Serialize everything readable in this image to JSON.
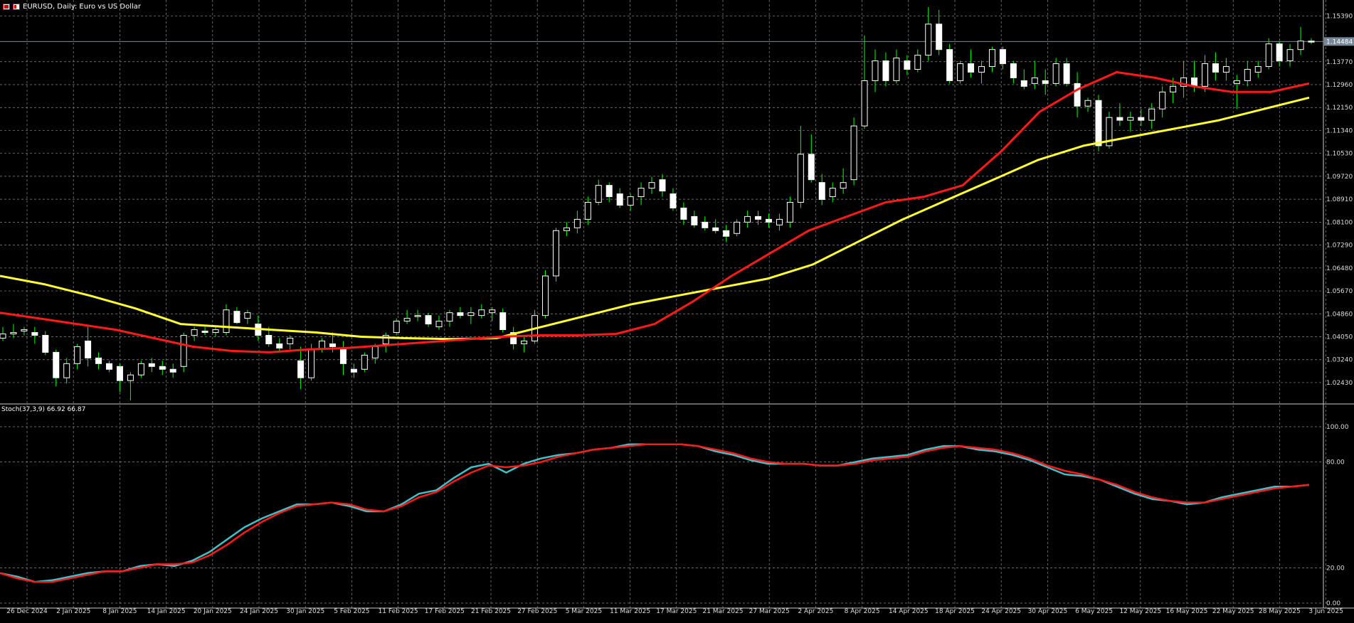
{
  "window": {
    "symbol_title": "EURUSD, Daily:  Euro vs US Dollar",
    "current_price_label": "1.14484"
  },
  "indicator": {
    "header": "Stoch(37,3,9) 66.92 66.87"
  },
  "colors": {
    "background": "#000000",
    "grid": "#8c8c8c",
    "candle_bull": "#ffffff",
    "candle_bear": "#ffffff",
    "wick": "#00ff00",
    "ma_fast": "#ff1a1a",
    "ma_slow": "#ffff33",
    "stoch_main": "#40c0c8",
    "stoch_signal": "#ff1a1a",
    "price_line": "#778899"
  },
  "chart_data": [
    {
      "type": "candlestick",
      "title": "EURUSD, Daily:  Euro vs US Dollar",
      "x_labels": [
        "26 Dec 2024",
        "2 Jan 2025",
        "8 Jan 2025",
        "14 Jan 2025",
        "20 Jan 2025",
        "24 Jan 2025",
        "30 Jan 2025",
        "5 Feb 2025",
        "11 Feb 2025",
        "17 Feb 2025",
        "21 Feb 2025",
        "27 Feb 2025",
        "5 Mar 2025",
        "11 Mar 2025",
        "17 Mar 2025",
        "21 Mar 2025",
        "27 Mar 2025",
        "2 Apr 2025",
        "8 Apr 2025",
        "14 Apr 2025",
        "18 Apr 2025",
        "24 Apr 2025",
        "30 Apr 2025",
        "6 May 2025",
        "12 May 2025",
        "16 May 2025",
        "22 May 2025",
        "28 May 2025",
        "3 Jun 2025"
      ],
      "y_ticks": [
        "1.15390",
        "1.14484",
        "1.13770",
        "1.12960",
        "1.12150",
        "1.11340",
        "1.10530",
        "1.09720",
        "1.08910",
        "1.08100",
        "1.07290",
        "1.06480",
        "1.05670",
        "1.04860",
        "1.04050",
        "1.03240",
        "1.02430"
      ],
      "ylim": [
        1.017,
        1.158
      ],
      "grid": true,
      "ohlc": [
        [
          1.04,
          1.044,
          1.039,
          1.0415
        ],
        [
          1.0415,
          1.045,
          1.04,
          1.042
        ],
        [
          1.0425,
          1.044,
          1.041,
          1.043
        ],
        [
          1.042,
          1.044,
          1.038,
          1.041
        ],
        [
          1.041,
          1.0425,
          1.034,
          1.035
        ],
        [
          1.035,
          1.036,
          1.023,
          1.026
        ],
        [
          1.026,
          1.033,
          1.024,
          1.031
        ],
        [
          1.031,
          1.038,
          1.029,
          1.037
        ],
        [
          1.039,
          1.044,
          1.03,
          1.033
        ],
        [
          1.033,
          1.035,
          1.029,
          1.031
        ],
        [
          1.031,
          1.032,
          1.028,
          1.029
        ],
        [
          1.03,
          1.031,
          1.021,
          1.025
        ],
        [
          1.025,
          1.028,
          1.018,
          1.027
        ],
        [
          1.027,
          1.032,
          1.026,
          1.031
        ],
        [
          1.031,
          1.033,
          1.028,
          1.03
        ],
        [
          1.03,
          1.032,
          1.027,
          1.029
        ],
        [
          1.029,
          1.031,
          1.026,
          1.028
        ],
        [
          1.03,
          1.042,
          1.028,
          1.041
        ],
        [
          1.041,
          1.044,
          1.039,
          1.043
        ],
        [
          1.0425,
          1.044,
          1.041,
          1.042
        ],
        [
          1.042,
          1.044,
          1.0405,
          1.043
        ],
        [
          1.042,
          1.052,
          1.041,
          1.05
        ],
        [
          1.0495,
          1.051,
          1.045,
          1.0455
        ],
        [
          1.047,
          1.05,
          1.045,
          1.049
        ],
        [
          1.045,
          1.048,
          1.039,
          1.041
        ],
        [
          1.041,
          1.044,
          1.037,
          1.038
        ],
        [
          1.038,
          1.04,
          1.035,
          1.0365
        ],
        [
          1.038,
          1.041,
          1.036,
          1.04
        ],
        [
          1.032,
          1.037,
          1.022,
          1.026
        ],
        [
          1.026,
          1.038,
          1.025,
          1.036
        ],
        [
          1.036,
          1.04,
          1.035,
          1.039
        ],
        [
          1.038,
          1.042,
          1.035,
          1.037
        ],
        [
          1.036,
          1.039,
          1.027,
          1.031
        ],
        [
          1.029,
          1.031,
          1.026,
          1.028
        ],
        [
          1.029,
          1.035,
          1.028,
          1.034
        ],
        [
          1.033,
          1.038,
          1.031,
          1.037
        ],
        [
          1.038,
          1.042,
          1.035,
          1.041
        ],
        [
          1.042,
          1.047,
          1.041,
          1.046
        ],
        [
          1.046,
          1.05,
          1.045,
          1.047
        ],
        [
          1.048,
          1.05,
          1.046,
          1.048
        ],
        [
          1.048,
          1.049,
          1.044,
          1.045
        ],
        [
          1.044,
          1.048,
          1.043,
          1.046
        ],
        [
          1.046,
          1.05,
          1.044,
          1.049
        ],
        [
          1.049,
          1.051,
          1.047,
          1.048
        ],
        [
          1.048,
          1.051,
          1.045,
          1.049
        ],
        [
          1.048,
          1.052,
          1.047,
          1.05
        ],
        [
          1.049,
          1.051,
          1.046,
          1.05
        ],
        [
          1.049,
          1.0505,
          1.042,
          1.043
        ],
        [
          1.042,
          1.044,
          1.036,
          1.038
        ],
        [
          1.038,
          1.041,
          1.035,
          1.039
        ],
        [
          1.039,
          1.05,
          1.038,
          1.048
        ],
        [
          1.048,
          1.064,
          1.047,
          1.062
        ],
        [
          1.062,
          1.079,
          1.06,
          1.078
        ],
        [
          1.078,
          1.081,
          1.076,
          1.079
        ],
        [
          1.079,
          1.085,
          1.077,
          1.082
        ],
        [
          1.082,
          1.09,
          1.08,
          1.088
        ],
        [
          1.088,
          1.096,
          1.087,
          1.094
        ],
        [
          1.094,
          1.095,
          1.088,
          1.09
        ],
        [
          1.091,
          1.093,
          1.086,
          1.087
        ],
        [
          1.087,
          1.091,
          1.085,
          1.09
        ],
        [
          1.09,
          1.095,
          1.087,
          1.093
        ],
        [
          1.093,
          1.097,
          1.091,
          1.095
        ],
        [
          1.096,
          1.098,
          1.09,
          1.092
        ],
        [
          1.091,
          1.093,
          1.085,
          1.086
        ],
        [
          1.086,
          1.088,
          1.08,
          1.082
        ],
        [
          1.083,
          1.085,
          1.079,
          1.08
        ],
        [
          1.081,
          1.083,
          1.078,
          1.079
        ],
        [
          1.079,
          1.082,
          1.077,
          1.078
        ],
        [
          1.078,
          1.08,
          1.074,
          1.076
        ],
        [
          1.077,
          1.082,
          1.076,
          1.081
        ],
        [
          1.081,
          1.085,
          1.079,
          1.083
        ],
        [
          1.083,
          1.085,
          1.08,
          1.082
        ],
        [
          1.082,
          1.084,
          1.079,
          1.081
        ],
        [
          1.08,
          1.084,
          1.078,
          1.082
        ],
        [
          1.081,
          1.09,
          1.079,
          1.088
        ],
        [
          1.088,
          1.115,
          1.086,
          1.105
        ],
        [
          1.105,
          1.112,
          1.095,
          1.096
        ],
        [
          1.095,
          1.098,
          1.087,
          1.089
        ],
        [
          1.09,
          1.095,
          1.088,
          1.093
        ],
        [
          1.093,
          1.1,
          1.091,
          1.095
        ],
        [
          1.096,
          1.118,
          1.094,
          1.115
        ],
        [
          1.115,
          1.147,
          1.114,
          1.131
        ],
        [
          1.131,
          1.142,
          1.127,
          1.138
        ],
        [
          1.138,
          1.141,
          1.129,
          1.131
        ],
        [
          1.131,
          1.142,
          1.13,
          1.139
        ],
        [
          1.138,
          1.14,
          1.133,
          1.135
        ],
        [
          1.135,
          1.142,
          1.134,
          1.14
        ],
        [
          1.14,
          1.157,
          1.138,
          1.151
        ],
        [
          1.151,
          1.156,
          1.14,
          1.142
        ],
        [
          1.142,
          1.144,
          1.13,
          1.131
        ],
        [
          1.131,
          1.138,
          1.13,
          1.137
        ],
        [
          1.137,
          1.142,
          1.132,
          1.134
        ],
        [
          1.134,
          1.138,
          1.13,
          1.136
        ],
        [
          1.136,
          1.143,
          1.134,
          1.142
        ],
        [
          1.142,
          1.143,
          1.135,
          1.137
        ],
        [
          1.137,
          1.138,
          1.13,
          1.132
        ],
        [
          1.131,
          1.135,
          1.128,
          1.129
        ],
        [
          1.13,
          1.138,
          1.128,
          1.132
        ],
        [
          1.131,
          1.135,
          1.126,
          1.13
        ],
        [
          1.13,
          1.139,
          1.129,
          1.137
        ],
        [
          1.137,
          1.139,
          1.129,
          1.13
        ],
        [
          1.13,
          1.134,
          1.118,
          1.122
        ],
        [
          1.122,
          1.125,
          1.12,
          1.124
        ],
        [
          1.124,
          1.126,
          1.106,
          1.108
        ],
        [
          1.108,
          1.12,
          1.107,
          1.118
        ],
        [
          1.118,
          1.123,
          1.115,
          1.117
        ],
        [
          1.117,
          1.12,
          1.113,
          1.118
        ],
        [
          1.118,
          1.121,
          1.115,
          1.117
        ],
        [
          1.117,
          1.123,
          1.114,
          1.121
        ],
        [
          1.121,
          1.129,
          1.118,
          1.127
        ],
        [
          1.127,
          1.132,
          1.123,
          1.129
        ],
        [
          1.129,
          1.138,
          1.125,
          1.132
        ],
        [
          1.132,
          1.138,
          1.127,
          1.129
        ],
        [
          1.129,
          1.14,
          1.127,
          1.137
        ],
        [
          1.137,
          1.141,
          1.131,
          1.134
        ],
        [
          1.134,
          1.139,
          1.131,
          1.136
        ],
        [
          1.13,
          1.133,
          1.121,
          1.131
        ],
        [
          1.131,
          1.138,
          1.129,
          1.135
        ],
        [
          1.134,
          1.138,
          1.132,
          1.136
        ],
        [
          1.136,
          1.146,
          1.135,
          1.144
        ],
        [
          1.144,
          1.145,
          1.136,
          1.138
        ],
        [
          1.138,
          1.144,
          1.136,
          1.142
        ],
        [
          1.142,
          1.15,
          1.14,
          1.145
        ],
        [
          1.145,
          1.146,
          1.144,
          1.1448
        ]
      ],
      "series": [
        {
          "name": "",
          "values": [
            1.049,
            1.047,
            1.045,
            1.043,
            1.04,
            1.037,
            1.0355,
            1.035,
            1.036,
            1.0365,
            1.0375,
            1.0385,
            1.0395,
            1.0405,
            1.041,
            1.041,
            1.0415,
            1.045,
            1.053,
            1.062,
            1.07,
            1.078,
            1.083,
            1.088,
            1.09,
            1.094,
            1.106,
            1.12,
            1.128,
            1.134,
            1.132,
            1.129,
            1.127,
            1.127,
            1.13
          ]
        },
        {
          "name": "",
          "values": [
            1.062,
            1.059,
            1.055,
            1.0505,
            1.045,
            1.044,
            1.043,
            1.042,
            1.0405,
            1.04,
            1.0397,
            1.04,
            1.044,
            1.048,
            1.052,
            1.055,
            1.058,
            1.061,
            1.066,
            1.074,
            1.082,
            1.089,
            1.096,
            1.103,
            1.108,
            1.111,
            1.114,
            1.117,
            1.121,
            1.125
          ]
        }
      ]
    },
    {
      "type": "line",
      "title": "Stoch(37,3,9) 66.92 66.87",
      "y_ticks": [
        "100.00",
        "80.00",
        "20.00",
        "0.00"
      ],
      "ylim": [
        0,
        100
      ],
      "series": [
        {
          "name": "",
          "values": [
            17,
            15,
            12,
            13,
            15,
            17,
            18,
            18,
            21,
            22,
            21,
            24,
            29,
            36,
            43,
            48,
            52,
            56,
            56,
            57,
            55,
            52,
            52,
            56,
            62,
            64,
            71,
            77,
            79,
            74,
            79,
            82,
            84,
            85,
            87,
            88,
            90,
            90,
            90,
            90,
            89,
            86,
            84,
            81,
            79,
            79,
            79,
            78,
            78,
            80,
            82,
            83,
            84,
            87,
            89,
            89,
            87,
            86,
            84,
            81,
            77,
            73,
            72,
            70,
            66,
            62,
            59,
            58,
            56,
            57,
            60,
            62,
            64,
            66,
            66,
            67
          ]
        },
        {
          "name": "",
          "values": [
            17,
            14,
            12,
            12,
            14,
            16,
            18,
            18,
            20,
            22,
            22,
            23,
            27,
            33,
            40,
            46,
            51,
            55,
            56,
            57,
            56,
            53,
            52,
            55,
            60,
            63,
            69,
            74,
            78,
            77,
            78,
            80,
            83,
            85,
            87,
            88,
            89,
            90,
            90,
            90,
            89,
            87,
            85,
            82,
            80,
            79,
            79,
            78,
            78,
            79,
            81,
            82,
            83,
            86,
            88,
            89,
            88,
            87,
            85,
            82,
            78,
            75,
            73,
            70,
            67,
            63,
            60,
            58,
            57,
            57,
            59,
            61,
            63,
            65,
            66,
            67
          ]
        }
      ]
    }
  ]
}
